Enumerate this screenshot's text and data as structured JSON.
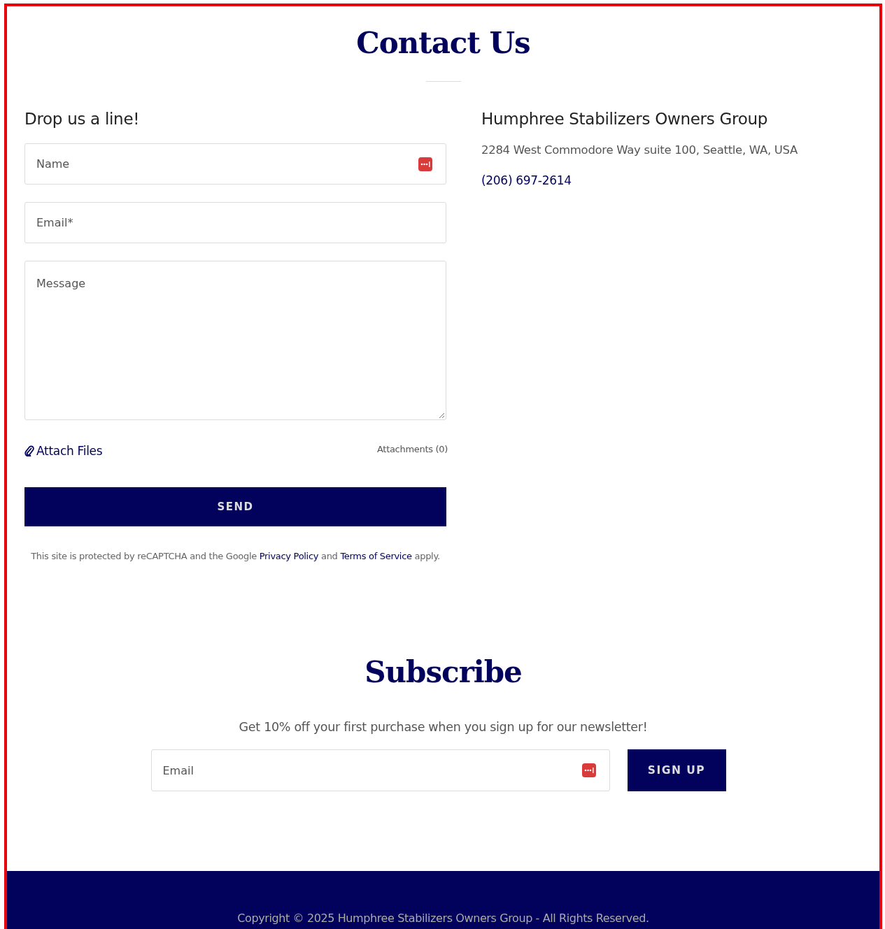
{
  "contact": {
    "title": "Contact Us",
    "form": {
      "heading": "Drop us a line!",
      "fields": [
        {
          "kind": "input",
          "placeholder": "Name",
          "autofill": true
        },
        {
          "kind": "input",
          "placeholder": "Email*",
          "autofill": false
        },
        {
          "kind": "textarea",
          "placeholder": "Message",
          "autofill": false
        }
      ],
      "attach_link": "Attach Files",
      "attachments": "Attachments (0)",
      "send_button": "SEND",
      "recaptcha": [
        {
          "kind": "plain",
          "text": "This site is protected by reCAPTCHA and the Google "
        },
        {
          "kind": "link",
          "text": "Privacy Policy"
        },
        {
          "kind": "plain",
          "text": " and "
        },
        {
          "kind": "link",
          "text": "Terms of Service"
        },
        {
          "kind": "plain",
          "text": " apply."
        }
      ]
    },
    "info": {
      "name": "Humphree Stabilizers Owners Group",
      "address": "2284 West Commodore Way suite 100, Seattle, WA, USA",
      "phone": "(206) 697-2614"
    }
  },
  "subscribe": {
    "title": "Subscribe",
    "text": "Get 10% off your first purchase when you sign up for our newsletter!",
    "field": {
      "placeholder": "Email",
      "autofill": true
    },
    "button": "SIGN UP"
  },
  "footer": {
    "copyright": "Copyright © 2025 Humphree Stabilizers Owners Group - All Rights Reserved."
  }
}
